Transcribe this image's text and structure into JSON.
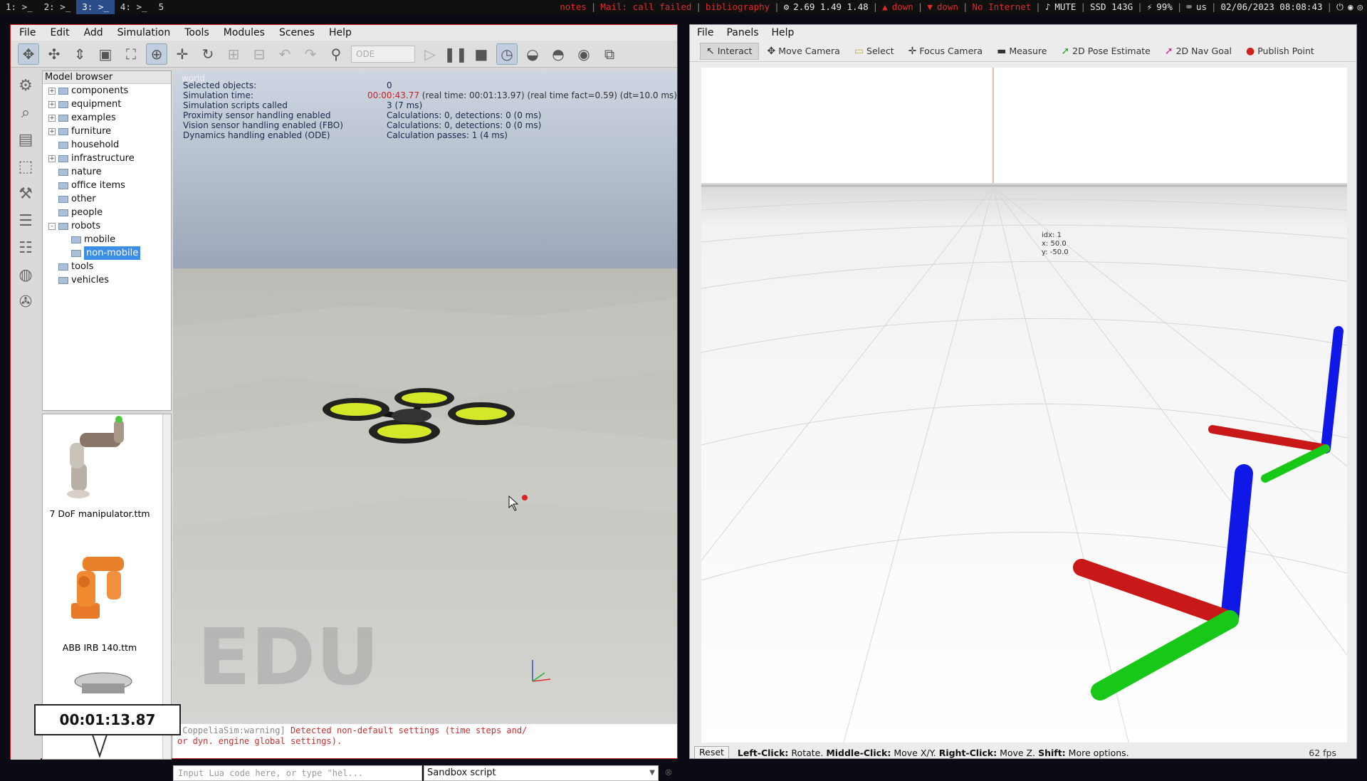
{
  "topbar": {
    "workspaces": [
      "1: >_",
      "2: >_",
      "3: >_",
      "4: >_",
      "5"
    ],
    "active_ws": 2,
    "status_red": [
      "notes",
      "Mail: call failed",
      "bibliography"
    ],
    "load": "2.69 1.49 1.48",
    "down1": "down",
    "down2": "down",
    "internet": "No Internet",
    "mute": "MUTE",
    "ssd": "SSD 143G",
    "battery": "99%",
    "kbd": "us",
    "datetime": "02/06/2023 08:08:43"
  },
  "coppelia": {
    "menu": [
      "File",
      "Edit",
      "Add",
      "Simulation",
      "Tools",
      "Modules",
      "Scenes",
      "Help"
    ],
    "engine_select": "ODE",
    "browser_title": "Model browser",
    "tree": [
      {
        "label": "components",
        "expand": "+",
        "level": 0
      },
      {
        "label": "equipment",
        "expand": "+",
        "level": 0
      },
      {
        "label": "examples",
        "expand": "+",
        "level": 0
      },
      {
        "label": "furniture",
        "expand": "+",
        "level": 0
      },
      {
        "label": "household",
        "expand": "",
        "level": 0
      },
      {
        "label": "infrastructure",
        "expand": "+",
        "level": 0
      },
      {
        "label": "nature",
        "expand": "",
        "level": 0
      },
      {
        "label": "office items",
        "expand": "",
        "level": 0
      },
      {
        "label": "other",
        "expand": "",
        "level": 0
      },
      {
        "label": "people",
        "expand": "",
        "level": 0
      },
      {
        "label": "robots",
        "expand": "-",
        "level": 0
      },
      {
        "label": "mobile",
        "expand": "",
        "level": 1
      },
      {
        "label": "non-mobile",
        "expand": "",
        "level": 1,
        "selected": true
      },
      {
        "label": "tools",
        "expand": "",
        "level": 0
      },
      {
        "label": "vehicles",
        "expand": "",
        "level": 0
      }
    ],
    "thumbs": [
      "7 DoF manipulator.ttm",
      "ABB IRB 140.ttm"
    ],
    "timer": "00:01:13.87",
    "scene_tab": "world",
    "info": [
      {
        "k": "Selected objects:",
        "v": "0"
      },
      {
        "k": "Simulation time:",
        "v": "00:00:43.77 (real time: 00:01:13.97) (real time fact=0.59) (dt=10.0 ms)"
      },
      {
        "k": "Simulation scripts called",
        "v": "3 (7 ms)"
      },
      {
        "k": "Proximity sensor handling enabled",
        "v": "Calculations: 0, detections: 0 (0 ms)"
      },
      {
        "k": "Vision sensor handling enabled (FBO)",
        "v": "Calculations: 0, detections: 0 (0 ms)"
      },
      {
        "k": "Dynamics handling enabled (ODE)",
        "v": "Calculation passes: 1 (4 ms)"
      }
    ],
    "watermark": "EDU",
    "console_line1_tag": "[CoppeliaSim:warning]",
    "console_line1_msg": "Detected non-default settings (time steps and/",
    "console_line2": "or dyn. engine global settings).",
    "lua_placeholder": "Input Lua code here, or type \"hel...",
    "sandbox": "Sandbox script"
  },
  "rviz": {
    "menu": [
      "File",
      "Panels",
      "Help"
    ],
    "tools": [
      {
        "label": "Interact",
        "icon": "cursor-icon"
      },
      {
        "label": "Move Camera",
        "icon": "move-icon"
      },
      {
        "label": "Select",
        "icon": "select-icon"
      },
      {
        "label": "Focus Camera",
        "icon": "focus-icon"
      },
      {
        "label": "Measure",
        "icon": "ruler-icon"
      },
      {
        "label": "2D Pose Estimate",
        "icon": "arrow-green-icon"
      },
      {
        "label": "2D Nav Goal",
        "icon": "arrow-pink-icon"
      },
      {
        "label": "Publish Point",
        "icon": "pin-icon"
      }
    ],
    "idx_lines": [
      "idx: 1",
      "x: 50.0",
      "y: -50.0"
    ],
    "reset": "Reset",
    "hint_b1": "Left-Click:",
    "hint_t1": "Rotate.",
    "hint_b2": "Middle-Click:",
    "hint_t2": "Move X/Y.",
    "hint_b3": "Right-Click:",
    "hint_t3": "Move Z.",
    "hint_b4": "Shift:",
    "hint_t4": "More options.",
    "fps": "62 fps"
  }
}
